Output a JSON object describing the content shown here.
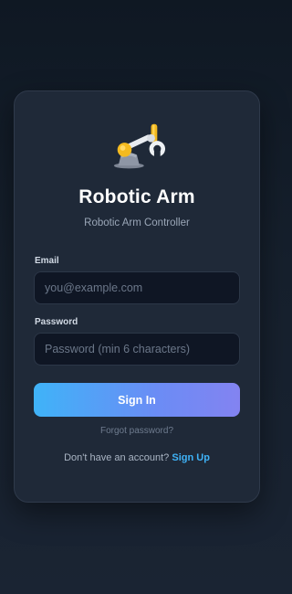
{
  "app": {
    "logo_icon": "robotic-arm-icon",
    "title": "Robotic Arm",
    "subtitle": "Robotic Arm Controller"
  },
  "form": {
    "email_label": "Email",
    "email_placeholder": "you@example.com",
    "email_value": "",
    "password_label": "Password",
    "password_placeholder": "Password (min 6 characters)",
    "password_value": "",
    "signin_label": "Sign In",
    "forgot_label": "Forgot password?",
    "signup_prompt": "Don't have an account?",
    "signup_label": "Sign Up"
  },
  "colors": {
    "background": "#16202d",
    "card": "#1f2938",
    "accent": "#3fb3f8",
    "button_gradient_end": "#8383f1"
  }
}
